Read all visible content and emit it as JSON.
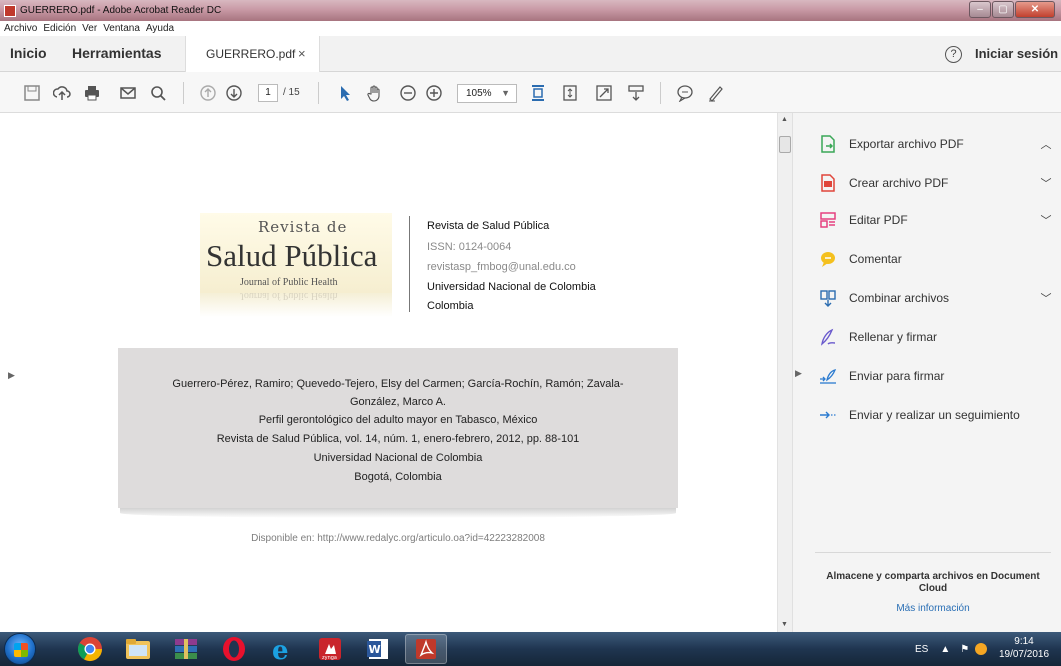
{
  "window": {
    "title": "GUERRERO.pdf - Adobe Acrobat Reader DC"
  },
  "menu": [
    "Archivo",
    "Edición",
    "Ver",
    "Ventana",
    "Ayuda"
  ],
  "tabs": {
    "home": "Inicio",
    "tools": "Herramientas",
    "document": "GUERRERO.pdf",
    "close": "×",
    "help": "?",
    "signin": "Iniciar sesión"
  },
  "toolbar": {
    "page_current": "1",
    "page_total": "/ 15",
    "zoom": "105%",
    "icons": [
      "save-icon",
      "upload-cloud-icon",
      "print-icon",
      "email-icon",
      "search-icon",
      "prev-page-icon",
      "next-page-icon",
      "select-arrow-icon",
      "hand-icon",
      "zoom-out-icon",
      "zoom-in-icon",
      "fit-page-icon",
      "scroll-mode-icon",
      "fullscreen-icon",
      "read-mode-icon",
      "comment-icon",
      "sign-pen-icon"
    ]
  },
  "document": {
    "logo": {
      "line1": "Revista de",
      "line2": "Salud Pública",
      "line3": "Journal of Public Health"
    },
    "journal_info": [
      {
        "text": "Revista de Salud Pública",
        "grey": false
      },
      {
        "text": "ISSN: 0124-0064",
        "grey": true
      },
      {
        "text": "revistasp_fmbog@unal.edu.co",
        "grey": true
      },
      {
        "text": "Universidad Nacional de Colombia",
        "grey": false
      },
      {
        "text": "Colombia",
        "grey": false
      }
    ],
    "citation": [
      "Guerrero-Pérez, Ramiro; Quevedo-Tejero, Elsy del Carmen; García-Rochín, Ramón; Zavala-",
      "González, Marco A.",
      "Perfil gerontológico del adulto mayor en Tabasco, México",
      "Revista de Salud Pública, vol. 14, núm. 1, enero-febrero, 2012, pp. 88-101",
      "Universidad Nacional de Colombia",
      "Bogotá, Colombia"
    ],
    "available": "Disponible en: http://www.redalyc.org/articulo.oa?id=42223282008"
  },
  "right_pane": {
    "tools": [
      {
        "label": "Exportar archivo PDF",
        "icon": "export-pdf-icon",
        "chevron": "up",
        "color": "#3aa757"
      },
      {
        "label": "Crear archivo PDF",
        "icon": "create-pdf-icon",
        "chevron": "down",
        "color": "#e0453a"
      },
      {
        "label": "Editar PDF",
        "icon": "edit-pdf-icon",
        "chevron": "down",
        "color": "#e5407f"
      },
      {
        "label": "Comentar",
        "icon": "comment-icon",
        "chevron": "",
        "color": "#f4c01e"
      },
      {
        "label": "Combinar archivos",
        "icon": "combine-files-icon",
        "chevron": "down",
        "color": "#2b6cb0"
      },
      {
        "label": "Rellenar y firmar",
        "icon": "fill-sign-icon",
        "chevron": "",
        "color": "#6a5acd"
      },
      {
        "label": "Enviar para firmar",
        "icon": "send-sign-icon",
        "chevron": "",
        "color": "#2b7bd0"
      },
      {
        "label": "Enviar y realizar un seguimiento",
        "icon": "send-track-icon",
        "chevron": "",
        "color": "#2b7bd0"
      }
    ],
    "cloud_text": "Almacene y comparta archivos en Document Cloud",
    "cloud_link": "Más información"
  },
  "taskbar": {
    "apps": [
      "chrome-icon",
      "file-explorer-icon",
      "winrar-icon",
      "opera-icon",
      "internet-explorer-icon",
      "zynga-icon",
      "word-icon",
      "acrobat-icon"
    ],
    "language": "ES",
    "time": "9:14",
    "date": "19/07/2016"
  }
}
